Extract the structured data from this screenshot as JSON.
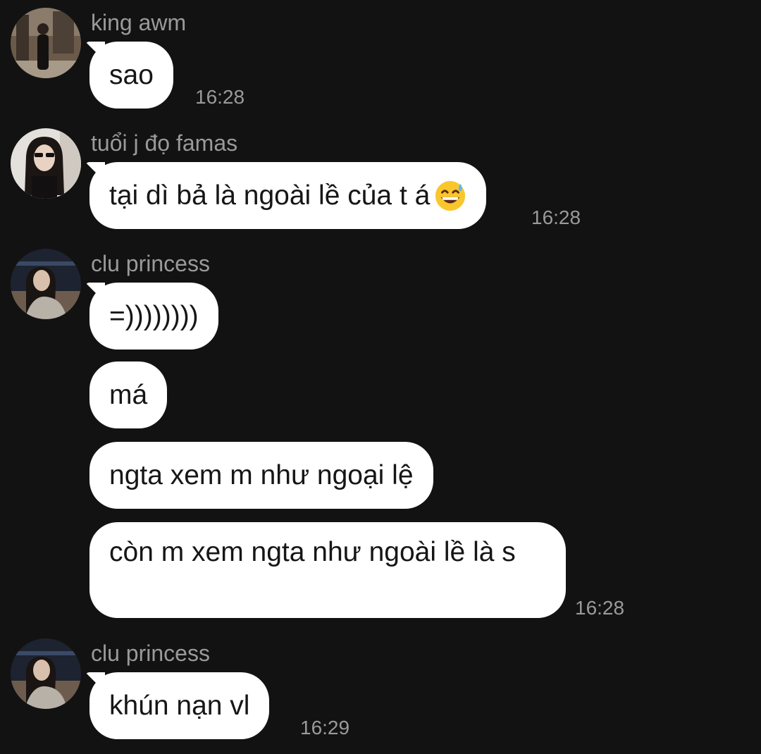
{
  "messages": [
    {
      "sender": "king awm",
      "text": "sao",
      "time": "16:28"
    },
    {
      "sender": "tuổi j đọ famas",
      "text": "tại dì bả là ngoài lề của t á",
      "emoji": "grinning-sweat-emoji",
      "time": "16:28"
    },
    {
      "sender": "clu princess",
      "texts": [
        "=))))))))",
        "má",
        "ngta xem m như ngoại lệ",
        "còn m xem ngta như ngoài lề là s"
      ],
      "time": "16:28"
    },
    {
      "sender": "clu princess",
      "text": "khún nạn vl",
      "time": "16:29"
    }
  ],
  "colors": {
    "background": "#121212",
    "bubble": "#ffffff",
    "meta_text": "#9a9a9a"
  }
}
